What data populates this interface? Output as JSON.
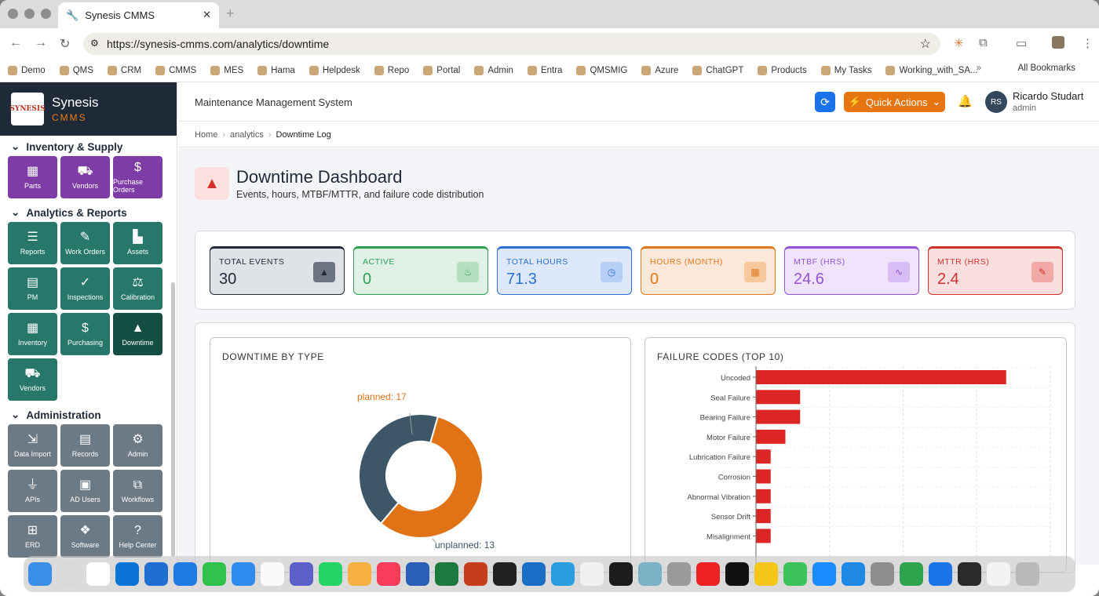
{
  "browser": {
    "tab_title": "Synesis CMMS",
    "url": "https://synesis-cmms.com/analytics/downtime",
    "bookmarks": [
      "Demo",
      "QMS",
      "CRM",
      "CMMS",
      "MES",
      "Hama",
      "Helpdesk",
      "Repo",
      "Portal",
      "Admin",
      "Entra",
      "QMSMIG",
      "Azure",
      "ChatGPT",
      "Products",
      "My Tasks",
      "Working_with_SA..."
    ],
    "all_bookmarks": "All Bookmarks"
  },
  "brand": {
    "name": "Synesis",
    "sub": "CMMS",
    "logo": "SYNESIS"
  },
  "sidebar": {
    "sections": [
      {
        "title": "Inventory & Supply",
        "color": "purple",
        "tiles": [
          {
            "label": "Parts",
            "icon": "boxes-icon"
          },
          {
            "label": "Vendors",
            "icon": "truck-icon"
          },
          {
            "label": "Purchase Orders",
            "icon": "invoice-icon"
          }
        ]
      },
      {
        "title": "Analytics & Reports",
        "color": "teal",
        "tiles": [
          {
            "label": "Reports",
            "icon": "list-icon"
          },
          {
            "label": "Work Orders",
            "icon": "wrench-icon"
          },
          {
            "label": "Assets",
            "icon": "factory-icon"
          },
          {
            "label": "PM",
            "icon": "calendar-icon"
          },
          {
            "label": "Inspections",
            "icon": "clipboard-icon"
          },
          {
            "label": "Calibration",
            "icon": "scale-icon"
          },
          {
            "label": "Inventory",
            "icon": "boxes-icon"
          },
          {
            "label": "Purchasing",
            "icon": "invoice-icon"
          },
          {
            "label": "Downtime",
            "icon": "warning-icon",
            "active": true
          },
          {
            "label": "Vendors",
            "icon": "truck-icon"
          }
        ]
      },
      {
        "title": "Administration",
        "color": "gray",
        "tiles": [
          {
            "label": "Data Import",
            "icon": "import-icon"
          },
          {
            "label": "Records",
            "icon": "table-icon"
          },
          {
            "label": "Admin",
            "icon": "gear-icon"
          },
          {
            "label": "APIs",
            "icon": "plug-icon"
          },
          {
            "label": "AD Users",
            "icon": "id-badge-icon"
          },
          {
            "label": "Workflows",
            "icon": "workflow-icon"
          },
          {
            "label": "ERD",
            "icon": "diagram-icon"
          },
          {
            "label": "Software",
            "icon": "cubes-icon"
          },
          {
            "label": "Help Center",
            "icon": "help-icon"
          }
        ]
      }
    ]
  },
  "topbar": {
    "title": "Maintenance Management System",
    "quick_actions": "Quick Actions",
    "user_initials": "RS",
    "user_name": "Ricardo Studart",
    "user_role": "admin"
  },
  "breadcrumb": {
    "home": "Home",
    "section": "analytics",
    "current": "Downtime Log"
  },
  "page": {
    "title": "Downtime Dashboard",
    "subtitle": "Events, hours, MTBF/MTTR, and failure code distribution"
  },
  "kpis": [
    {
      "label": "TOTAL EVENTS",
      "value": "30",
      "icon": "warning-icon",
      "border": "#1f2a38",
      "bg": "#dfe2e6",
      "fg": "#1f2a38",
      "badge": "#6b7480"
    },
    {
      "label": "ACTIVE",
      "value": "0",
      "icon": "fire-icon",
      "border": "#2f9e57",
      "bg": "#dff1e4",
      "fg": "#2f9e57",
      "badge": "#b3dfbf"
    },
    {
      "label": "TOTAL HOURS",
      "value": "71.3",
      "icon": "clock-icon",
      "border": "#2b6fd6",
      "bg": "#dde9fb",
      "fg": "#2b6fd6",
      "badge": "#b7cff4"
    },
    {
      "label": "HOURS (MONTH)",
      "value": "0",
      "icon": "calendar-icon",
      "border": "#e2781d",
      "bg": "#fbe8d8",
      "fg": "#e2781d",
      "badge": "#f6c89c"
    },
    {
      "label": "MTBF (HRS)",
      "value": "24.6",
      "icon": "wave-icon",
      "border": "#9253d6",
      "bg": "#efe4fb",
      "fg": "#9253d6",
      "badge": "#d7bdf4"
    },
    {
      "label": "MTTR (HRS)",
      "value": "2.4",
      "icon": "wrench-icon",
      "border": "#d0312d",
      "bg": "#fadfde",
      "fg": "#d0312d",
      "badge": "#f1a9a6"
    }
  ],
  "chart_data": [
    {
      "type": "pie",
      "title": "DOWNTIME BY TYPE",
      "categories": [
        "planned",
        "unplanned"
      ],
      "values": [
        17,
        13
      ],
      "colors": [
        "#e07316",
        "#3d5668"
      ],
      "labels": [
        "planned: 17",
        "unplanned: 13"
      ]
    },
    {
      "type": "bar",
      "orientation": "horizontal",
      "title": "FAILURE CODES (TOP 10)",
      "categories": [
        "Uncoded",
        "Seal Failure",
        "Bearing Failure",
        "Motor Failure",
        "Lubrication Failure",
        "Corrosion",
        "Abnormal Vibration",
        "Sensor Drift",
        "Misalignment"
      ],
      "values": [
        17,
        3,
        3,
        2,
        1,
        1,
        1,
        1,
        1
      ],
      "color": "#dc2626",
      "xlim": [
        0,
        20
      ],
      "grid": true
    }
  ]
}
